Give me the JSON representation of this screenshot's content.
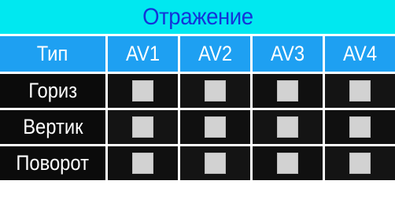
{
  "title": "Отражение",
  "header": {
    "type_label": "Тип",
    "columns": [
      "AV1",
      "AV2",
      "AV3",
      "AV4"
    ]
  },
  "rows": [
    {
      "label": "Гориз",
      "checked": [
        false,
        false,
        false,
        false
      ]
    },
    {
      "label": "Вертик",
      "checked": [
        false,
        false,
        false,
        false
      ]
    },
    {
      "label": "Поворот",
      "checked": [
        false,
        false,
        false,
        false
      ]
    }
  ],
  "colors": {
    "title_bg": "#00e8f0",
    "title_text": "#1434d8",
    "header_bg": "#1ea0f2",
    "cell_bg": "#141414",
    "checkbox": "#d2d2d2"
  }
}
